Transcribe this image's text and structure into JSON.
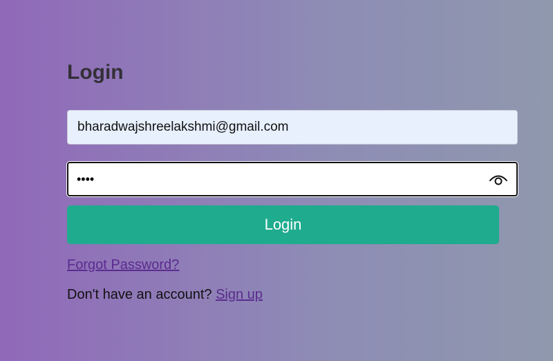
{
  "login": {
    "title": "Login",
    "email_value": "bharadwajshreelakshmi@gmail.com",
    "password_masked": "••••",
    "submit_label": "Login",
    "forgot_label": "Forgot Password?",
    "signup_prompt": "Don't have an account?",
    "signup_label": "Sign up"
  },
  "icons": {
    "password_toggle": "eye-icon"
  },
  "colors": {
    "submit_button": "#1fab8e",
    "link": "#5a2b8f",
    "email_field_bg": "#e8f0fe"
  }
}
